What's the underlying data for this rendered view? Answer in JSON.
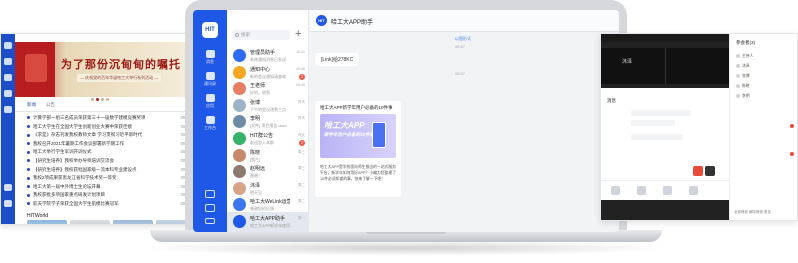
{
  "left_window": {
    "banner_title": "为了那份沉甸甸的嘱托",
    "banner_subtitle": "— 庆祝党的百年华诞哈工大举行系列活动 —",
    "tabs": [
      "新闻",
      "公告"
    ],
    "news": [
      {
        "text": "计算学部一组三名成员荣获第三十一届数学建模竞赛奖项",
        "date": "09-10"
      },
      {
        "text": "哈工大学生在全国大学生创新创业大赛中荣获佳绩",
        "date": "09-09"
      },
      {
        "text": "《求是》杂志刊发我校教师文章 学习贯彻习近平新时代",
        "date": "09-09"
      },
      {
        "text": "我校召开2021年暑期工作会议部署新学期工作",
        "date": "09-08"
      },
      {
        "text": "哈工大举行学生军训开训仪式",
        "date": "09-07"
      },
      {
        "text": "【研究生培养】我校举办导师培训交流会",
        "date": "09-06"
      },
      {
        "text": "【研究生培养】我校获批国家级一流本科专业建设点",
        "date": "09-05"
      },
      {
        "text": "我校2项成果获黑龙江省科学技术奖一等奖",
        "date": "09-04"
      },
      {
        "text": "哈工大第一届中外博士生论坛开幕",
        "date": "09-03"
      },
      {
        "text": "我校获批多项国家重点研发计划项目",
        "date": "09-02"
      },
      {
        "text": "航天学院学子荣获全国大学生航模比赛冠军",
        "date": "09-01"
      }
    ],
    "section_title": "HITWorld",
    "thumbnails": [
      "校园风景",
      "学术报告",
      "科研创新",
      "学生风采"
    ]
  },
  "rail": {
    "logo": "HIT",
    "items": [
      "消息",
      "通讯录",
      "应用",
      "工作台"
    ]
  },
  "contact_list": {
    "search_placeholder": "搜索",
    "add_symbol": "+",
    "items": [
      {
        "name": "管理员助手",
        "msg": "系统通知消息已发送",
        "time": "10:21",
        "color": "#2f6bf3",
        "badge": ""
      },
      {
        "name": "通知中心",
        "msg": "新的会议通知请查收",
        "time": "09:58",
        "color": "#f5a623",
        "badge": "3"
      },
      {
        "name": "王老师",
        "msg": "好的，收到",
        "time": "09:45",
        "color": "#e67e63",
        "badge": ""
      },
      {
        "name": "张博",
        "msg": "下午的会议改到三点",
        "time": "昨天",
        "color": "#9fb3c8",
        "badge": ""
      },
      {
        "name": "李明",
        "msg": "[文件] 项目报告.docx",
        "time": "昨天",
        "color": "#6d8ba4",
        "badge": ""
      },
      {
        "name": "HIT群公告",
        "msg": "欢迎加入本群",
        "time": "昨天",
        "color": "#35b36b",
        "badge": "2"
      },
      {
        "name": "陈晓",
        "msg": "[图片]",
        "time": "周三",
        "color": "#c58a6a",
        "badge": ""
      },
      {
        "name": "赵明远",
        "msg": "谢谢！",
        "time": "周三",
        "color": "#8b7b6e",
        "badge": ""
      },
      {
        "name": "沐泽",
        "msg": "明天见",
        "time": "周二",
        "color": "#d9a38a",
        "badge": ""
      },
      {
        "name": "哈工大WeLink运营客...",
        "msg": "感谢您的反馈",
        "time": "周二",
        "color": "#3f74f0",
        "badge": ""
      },
      {
        "name": "哈工大APP助手",
        "msg": "哈工大APP新学年使用...",
        "time": "周一",
        "color": "#1f57e6",
        "badge": ""
      }
    ]
  },
  "chat": {
    "header_title": "哈工大APP助手",
    "system_msg": "以图形式",
    "time_1": "08:57",
    "bubble_text": "[Link]给278KC",
    "time_2": "08:57",
    "card_title": "哈工大APP新学年用户必备的10件事",
    "card_img_title": "哈工大APP",
    "card_img_subtitle": "新学年用户必备的10件事",
    "card_desc": "哈工大APP是学校面向师生推出的一站式服务平台，新学年如何用好APP？小编为您整理了10件必须知道的事，快来了解一下吧！"
  },
  "right_window": {
    "meeting_name": "沐泽",
    "panel_title": "参会者(3)",
    "phone_header": "消息",
    "panel_rows": [
      "主持人",
      "沐泽",
      "张博",
      "陈晓",
      "李明"
    ],
    "panel_bottom": "全部静音  解除静音  更多"
  }
}
